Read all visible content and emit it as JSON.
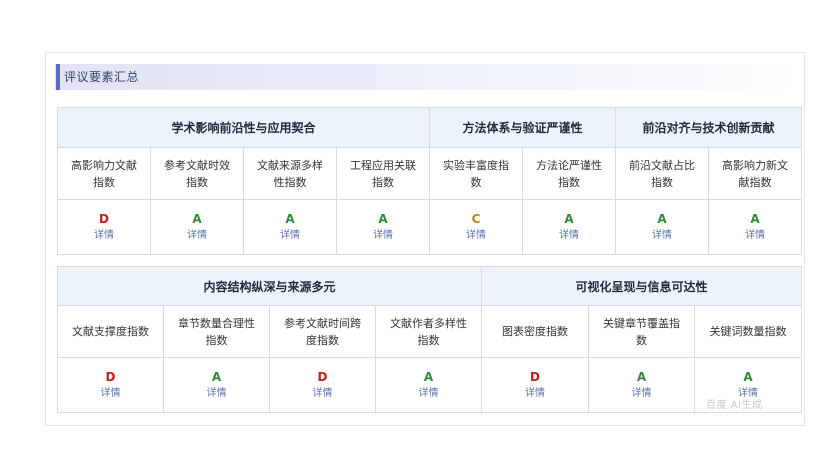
{
  "section_title": "评议要素汇总",
  "grade_colors": {
    "A": "#2e8b3a",
    "C": "#b8860b",
    "D": "#c0201a"
  },
  "table1": {
    "groups": [
      {
        "label": "学术影响前沿性与应用契合",
        "span": 4
      },
      {
        "label": "方法体系与验证严谨性",
        "span": 2
      },
      {
        "label": "前沿对齐与技术创新贡献",
        "span": 2
      }
    ],
    "metrics": [
      {
        "label": "高影响力文献指数",
        "grade": "D",
        "detail": "详情"
      },
      {
        "label": "参考文献时效指数",
        "grade": "A",
        "detail": "详情"
      },
      {
        "label": "文献来源多样性指数",
        "grade": "A",
        "detail": "详情"
      },
      {
        "label": "工程应用关联指数",
        "grade": "A",
        "detail": "详情"
      },
      {
        "label": "实验丰富度指数",
        "grade": "C",
        "detail": "详情"
      },
      {
        "label": "方法论严谨性指数",
        "grade": "A",
        "detail": "详情"
      },
      {
        "label": "前沿文献占比指数",
        "grade": "A",
        "detail": "详情"
      },
      {
        "label": "高影响力新文献指数",
        "grade": "A",
        "detail": "详情"
      }
    ]
  },
  "table2": {
    "groups": [
      {
        "label": "内容结构纵深与来源多元",
        "span": 4
      },
      {
        "label": "可视化呈现与信息可达性",
        "span": 3
      }
    ],
    "metrics": [
      {
        "label": "文献支撑度指数",
        "grade": "D",
        "detail": "详情"
      },
      {
        "label": "章节数量合理性指数",
        "grade": "A",
        "detail": "详情"
      },
      {
        "label": "参考文献时间跨度指数",
        "grade": "D",
        "detail": "详情"
      },
      {
        "label": "文献作者多样性指数",
        "grade": "A",
        "detail": "详情"
      },
      {
        "label": "图表密度指数",
        "grade": "D",
        "detail": "详情"
      },
      {
        "label": "关键章节覆盖指数",
        "grade": "A",
        "detail": "详情"
      },
      {
        "label": "关键词数量指数",
        "grade": "A",
        "detail": "详情"
      }
    ]
  },
  "watermark": "百度 AI生成"
}
